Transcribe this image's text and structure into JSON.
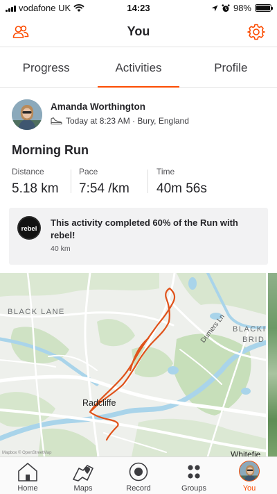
{
  "status_bar": {
    "carrier": "vodafone UK",
    "time": "14:23",
    "battery": "98%"
  },
  "header": {
    "title": "You"
  },
  "tabs": [
    {
      "label": "Progress",
      "active": false
    },
    {
      "label": "Activities",
      "active": true
    },
    {
      "label": "Profile",
      "active": false
    }
  ],
  "activity": {
    "athlete_name": "Amanda Worthington",
    "meta": "Today at 8:23 AM · Bury, England",
    "title": "Morning Run",
    "stats": [
      {
        "label": "Distance",
        "value": "5.18 km"
      },
      {
        "label": "Pace",
        "value": "7:54 /km"
      },
      {
        "label": "Time",
        "value": "40m 56s"
      }
    ]
  },
  "challenge": {
    "badge_text": "rebel",
    "text": "This activity completed 60% of the Run with rebel!",
    "sub": "40 km"
  },
  "map": {
    "labels": {
      "black_lane": "BLACK LANE",
      "black_brid_1": "BLACKI",
      "black_brid_2": "BRID",
      "radcliffe": "Radcliffe",
      "dumers_ln": "Dumers Ln",
      "whitefield": "Whitefie",
      "credit": "Mapbox © OpenStreetMap"
    },
    "route_color": "#e0521a"
  },
  "bottom_nav": [
    {
      "label": "Home",
      "icon": "home-icon",
      "active": false
    },
    {
      "label": "Maps",
      "icon": "map-icon",
      "active": false
    },
    {
      "label": "Record",
      "icon": "record-icon",
      "active": false
    },
    {
      "label": "Groups",
      "icon": "groups-icon",
      "active": false
    },
    {
      "label": "You",
      "icon": "avatar",
      "active": true
    }
  ],
  "colors": {
    "accent": "#fc4c02",
    "text": "#242428",
    "card_bg": "#f2f2f3"
  }
}
